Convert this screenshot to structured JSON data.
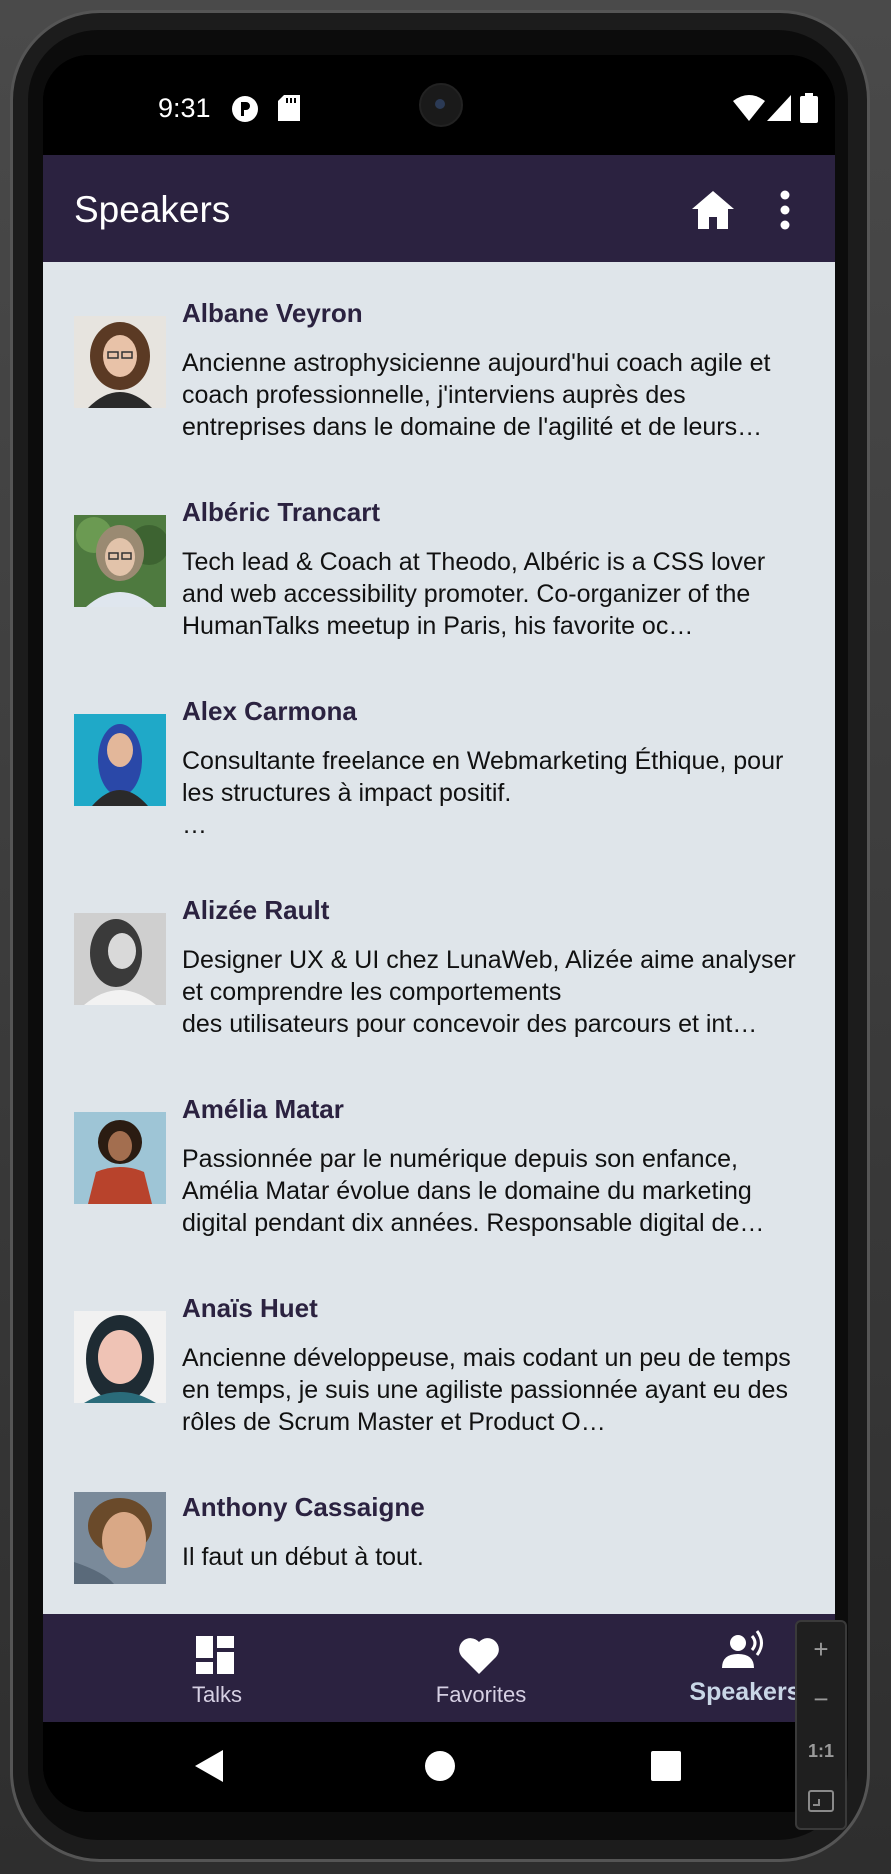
{
  "status_bar": {
    "time": "9:31",
    "icons": [
      "notification-p-icon",
      "sd-card-icon",
      "wifi-icon",
      "signal-icon",
      "battery-icon"
    ]
  },
  "app_bar": {
    "title": "Speakers",
    "actions": [
      "home-icon",
      "more-vert-icon"
    ]
  },
  "speakers": [
    {
      "name": "Albane Veyron",
      "bio": "Ancienne astrophysicienne aujourd'hui coach agile et coach professionnelle, j'interviens auprès des entreprises dans le domaine de l'agilité et de leurs…"
    },
    {
      "name": "Albéric Trancart",
      "bio": "Tech lead & Coach at Theodo, Albéric is a CSS lover and web accessibility promoter. Co-organizer of the HumanTalks meetup in Paris, his favorite oc…"
    },
    {
      "name": "Alex Carmona",
      "bio": "Consultante freelance en Webmarketing Éthique, pour les structures à impact positif.\n …"
    },
    {
      "name": "Alizée Rault",
      "bio": "Designer UX & UI chez LunaWeb, Alizée aime analyser et comprendre les comportements\ndes utilisateurs pour concevoir des parcours et int…"
    },
    {
      "name": "Amélia Matar",
      "bio": "Passionnée par le numérique depuis son enfance, Amélia Matar évolue dans le domaine du marketing digital pendant dix années. Responsable digital de…"
    },
    {
      "name": "Anaïs Huet",
      "bio": "Ancienne développeuse, mais codant un peu de temps en temps, je suis une agiliste passionnée ayant eu des rôles de Scrum Master et Product O…"
    },
    {
      "name": "Anthony Cassaigne",
      "bio": "Il faut un début à tout."
    }
  ],
  "bottom_nav": {
    "talks": "Talks",
    "favorites": "Favorites",
    "speakers": "Speakers",
    "active": "speakers"
  },
  "zoom_controls": {
    "zoom_in": "+",
    "zoom_out": "−",
    "one_to_one": "1:1"
  },
  "colors": {
    "app_bar": "#2b2240",
    "list_background": "#dfe5ea",
    "speaker_name": "#2b2240"
  }
}
